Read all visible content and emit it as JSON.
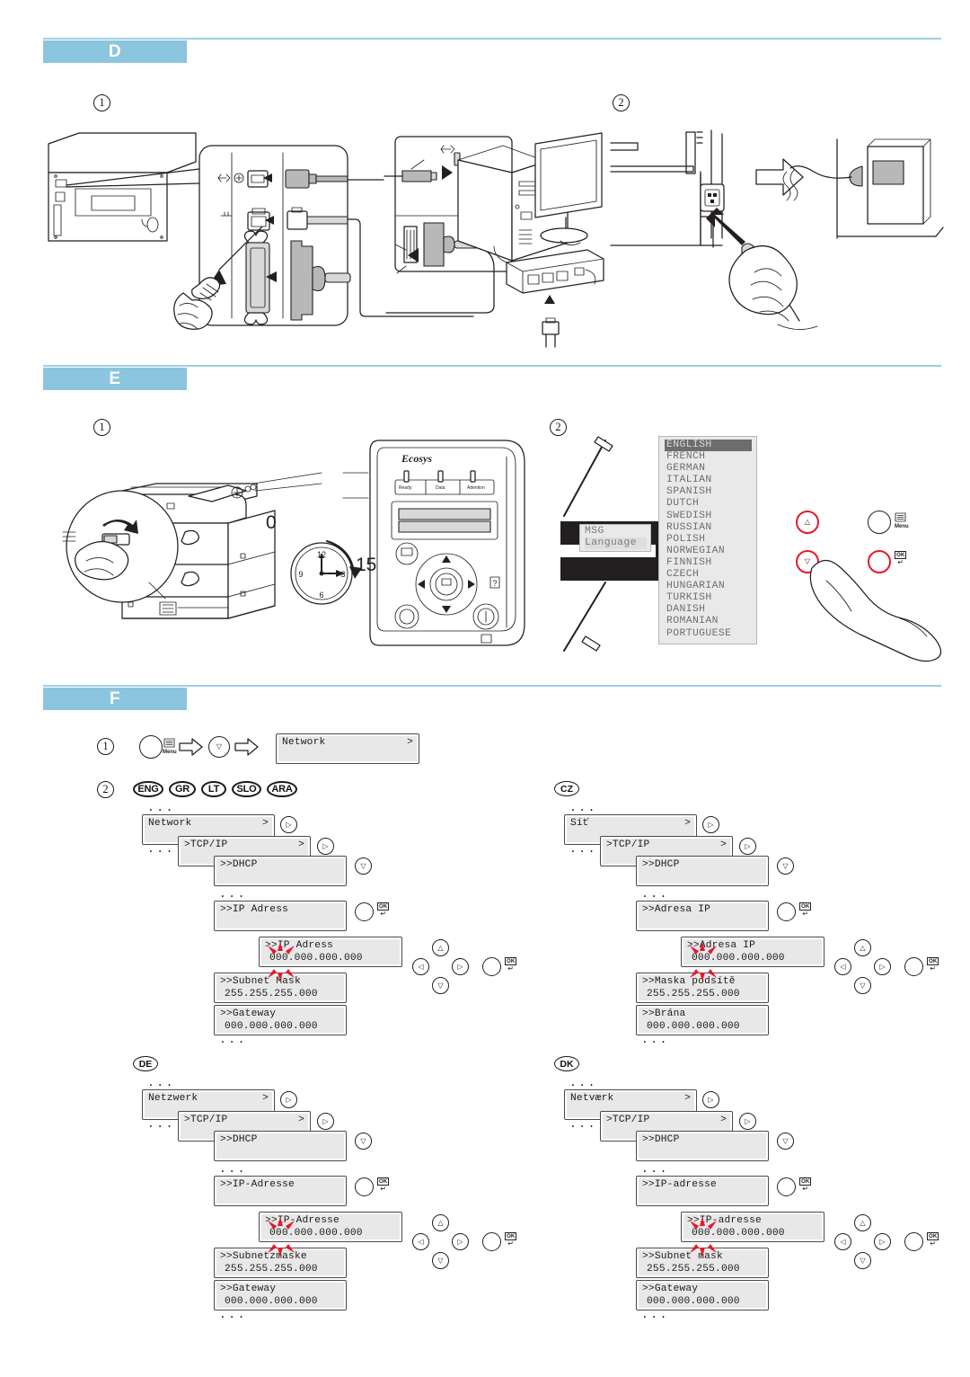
{
  "sections": [
    {
      "id": "D",
      "label": "D",
      "steps": [
        "1",
        "2"
      ]
    },
    {
      "id": "E",
      "label": "E",
      "steps": [
        "1",
        "2"
      ]
    },
    {
      "id": "F",
      "label": "F",
      "steps": [
        "1",
        "2"
      ]
    }
  ],
  "section_d": {
    "step1_caption": "1",
    "step2_caption": "2",
    "icons": [
      "usb-port-icon",
      "network-port-icon",
      "parallel-port-icon",
      "power-inlet-icon",
      "wall-outlet-icon"
    ]
  },
  "section_e": {
    "timer": {
      "start": "0",
      "end": "15",
      "marks": [
        "12",
        "3",
        "6",
        "9"
      ]
    },
    "control_panel": {
      "brand": "Ecosys",
      "indicators": [
        "Ready",
        "Data",
        "Attention"
      ]
    },
    "display": {
      "line1": "MSG",
      "line2": "Language"
    },
    "languages": [
      "ENGLISH",
      "FRENCH",
      "GERMAN",
      "ITALIAN",
      "SPANISH",
      "DUTCH",
      "SWEDISH",
      "RUSSIAN",
      "POLISH",
      "NORWEGIAN",
      "FINNISH",
      "CZECH",
      "HUNGARIAN",
      "TURKISH",
      "DANISH",
      "ROMANIAN",
      "PORTUGUESE"
    ],
    "selected_language": "ENGLISH",
    "keys": {
      "up": "△",
      "down": "▽",
      "menu": "Menu",
      "ok": "OK"
    }
  },
  "section_f": {
    "step1": {
      "menu_label": "Menu",
      "down_key": "▽",
      "display": {
        "title": "Network",
        "arrow": ">"
      }
    },
    "step2_badges": [
      "ENG",
      "GR",
      "LT",
      "SLO",
      "ARA"
    ],
    "panels": [
      {
        "code": "ENG",
        "network": "Network",
        "tcpip": ">TCP/IP",
        "dhcp": ">>DHCP",
        "ip_label": ">>IP Adress",
        "ip_edit_label": ">>IP Adress",
        "ip_value": "000.000.000.000",
        "subnet_label": ">>Subnet Mask",
        "subnet_value": "255.255.255.000",
        "gateway_label": ">>Gateway",
        "gateway_value": "000.000.000.000",
        "arrow": ">",
        "ellipsis": "..."
      },
      {
        "code": "CZ",
        "network": "Síť",
        "tcpip": ">TCP/IP",
        "dhcp": ">>DHCP",
        "ip_label": ">>Adresa IP",
        "ip_edit_label": ">>Adresa IP",
        "ip_value": "000.000.000.000",
        "subnet_label": ">>Maska podsítě",
        "subnet_value": "255.255.255.000",
        "gateway_label": ">>Brána",
        "gateway_value": "000.000.000.000",
        "arrow": ">",
        "ellipsis": "..."
      },
      {
        "code": "DE",
        "network": "Netzwerk",
        "tcpip": ">TCP/IP",
        "dhcp": ">>DHCP",
        "ip_label": ">>IP-Adresse",
        "ip_edit_label": ">>IP-Adresse",
        "ip_value": "000.000.000.000",
        "subnet_label": ">>Subnetzmaske",
        "subnet_value": "255.255.255.000",
        "gateway_label": ">>Gateway",
        "gateway_value": "000.000.000.000",
        "arrow": ">",
        "ellipsis": "..."
      },
      {
        "code": "DK",
        "network": "Netværk",
        "tcpip": ">TCP/IP",
        "dhcp": ">>DHCP",
        "ip_label": ">>IP-adresse",
        "ip_edit_label": ">>IP-adresse",
        "ip_value": "000.000.000.000",
        "subnet_label": ">>Subnet mask",
        "subnet_value": "255.255.255.000",
        "gateway_label": ">>Gateway",
        "gateway_value": "000.000.000.000",
        "arrow": ">",
        "ellipsis": "..."
      }
    ],
    "nav_keys": {
      "up": "△",
      "down": "▽",
      "left": "◁",
      "right": "▷",
      "ok": "OK"
    }
  },
  "colors": {
    "accent": "#8cc5de",
    "rule": "#9ccfe4",
    "highlight": "#e8172b",
    "lcd_bg": "#e8e8e8",
    "ink": "#231f20"
  }
}
